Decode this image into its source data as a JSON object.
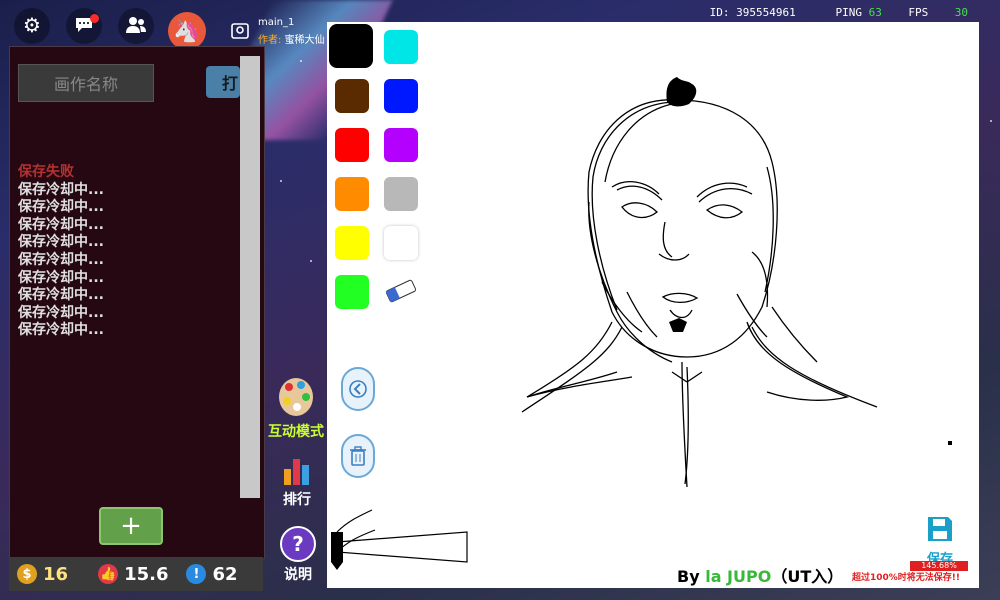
{
  "topbar": {
    "map_name": "main_1",
    "author_label": "作者:",
    "author_name": "蜜稀大仙",
    "id_text": "ID: 395554961",
    "ping_label": "PING",
    "ping_value": "63",
    "fps_label": "FPS",
    "fps_value": "30"
  },
  "panel": {
    "name_placeholder": "画作名称",
    "open_button": "打",
    "add_button": "+",
    "log": [
      "保存失败",
      "保存冷却中...",
      "保存冷却中...",
      "保存冷却中...",
      "保存冷却中...",
      "保存冷却中...",
      "保存冷却中...",
      "保存冷却中...",
      "保存冷却中...",
      "保存冷却中..."
    ]
  },
  "stats": {
    "coins": "16",
    "likes": "15.6",
    "alerts": "62"
  },
  "side": {
    "interact_label": "互动模式",
    "rank_label": "排行",
    "help_label": "说明"
  },
  "palette": [
    "#000000",
    "#00e5e5",
    "#5a2a00",
    "#0018ff",
    "#ff0000",
    "#b400ff",
    "#ff8c00",
    "#b8b8b8",
    "#ffff00",
    "#ffffff",
    "#22ff22"
  ],
  "canvas": {
    "byline_prefix": "By ",
    "byline_name": "la JUPO",
    "byline_suffix": "（UT入）",
    "save_label": "保存",
    "save_percent": "145.68%",
    "save_warning": "超过100%时将无法保存!!"
  }
}
